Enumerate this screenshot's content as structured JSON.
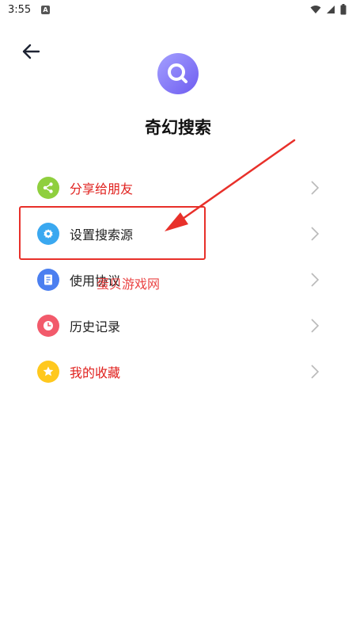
{
  "status_bar": {
    "time": "3:55",
    "notification_glyph": "A",
    "icons": [
      "wifi-icon",
      "signal-icon",
      "battery-icon"
    ]
  },
  "header": {
    "back_icon": "arrow-left-icon",
    "app_title": "奇幻搜索",
    "logo_icon": "search-magnifier-icon",
    "logo_colors": [
      "#a4a0ff",
      "#6e5cf0"
    ]
  },
  "menu": {
    "items": [
      {
        "label": "分享给朋友",
        "icon": "share-icon",
        "icon_color": "#8fcf3e",
        "label_color": "red"
      },
      {
        "label": "设置搜索源",
        "icon": "gear-icon",
        "icon_color": "#3aa8f0",
        "label_color": "default"
      },
      {
        "label": "使用协议",
        "icon": "document-icon",
        "icon_color": "#4b7ff0",
        "label_color": "default"
      },
      {
        "label": "历史记录",
        "icon": "clock-icon",
        "icon_color": "#f25a6b",
        "label_color": "default"
      },
      {
        "label": "我的收藏",
        "icon": "star-icon",
        "icon_color": "#ffc81e",
        "label_color": "red"
      }
    ],
    "chevron_icon": "chevron-right-icon"
  },
  "annotation": {
    "highlight_color": "#e8302a",
    "watermark_text": "蛋贝游戏网"
  }
}
